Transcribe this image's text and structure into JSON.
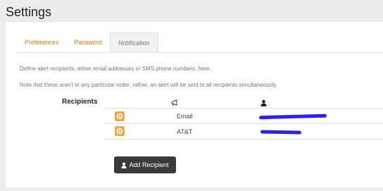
{
  "page": {
    "title": "Settings"
  },
  "tabs": [
    {
      "label": "Preferences"
    },
    {
      "label": "Password"
    },
    {
      "label": "Notification"
    }
  ],
  "description": {
    "line1": "Define alert recipients, either email addresses or SMS phone numbers, here.",
    "line2": "Note that these aren't in any particular order: rather, an alert will be sent to all recipients simultaneously."
  },
  "recipients": {
    "header": "Recipients",
    "rows": [
      {
        "type": "Email"
      },
      {
        "type": "AT&T"
      }
    ]
  },
  "actions": {
    "add_label": "Add Recipient"
  },
  "colors": {
    "accent": "#f0ad4e",
    "tab_link": "#c8822d",
    "button_dark": "#3a3a3a",
    "redaction": "#2a24e6"
  },
  "icons": {
    "type_column": "bullhorn-icon",
    "recipient_column": "user-icon",
    "delete": "close-icon",
    "add": "user-icon"
  }
}
